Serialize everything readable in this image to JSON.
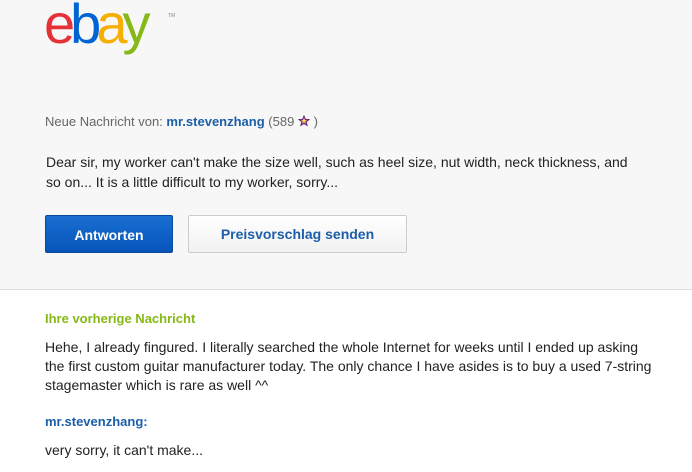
{
  "brand": {
    "logo_letters": [
      "e",
      "b",
      "a",
      "y"
    ],
    "logo_colors": [
      "#e53238",
      "#0064d2",
      "#f5af02",
      "#86b817"
    ],
    "trademark": "TM"
  },
  "header": {
    "new_message_label": "Neue Nachricht von:",
    "username": "mr.stevenzhang",
    "feedback_open": "(589",
    "feedback_close": ")",
    "feedback_star_icon": "purple-star-icon",
    "star_color": "#7b2f9c"
  },
  "message": {
    "body": "Dear sir, my worker can't make the size well, such as heel size, nut width, neck thickness, and so on... It is a little difficult to my worker, sorry..."
  },
  "actions": {
    "reply_label": "Antworten",
    "offer_label": "Preisvorschlag senden"
  },
  "previous": {
    "heading": "Ihre vorherige Nachricht",
    "body": "Hehe, I already fingured. I literally searched the whole Internet for weeks until I ended up asking the first custom guitar manufacturer today. The only chance I have asides is to buy a used 7-string stagemaster which is rare as well ^^",
    "reply_user": "mr.stevenzhang:",
    "reply_text": "very sorry, it can't make..."
  }
}
